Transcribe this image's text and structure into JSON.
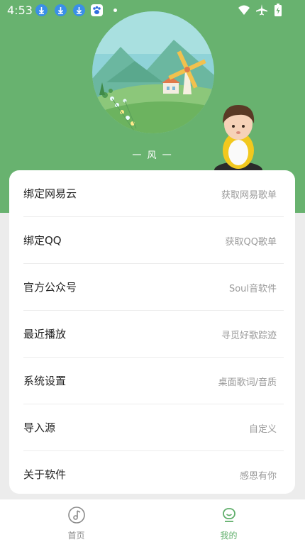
{
  "status_bar": {
    "time": "4:53",
    "notification_icons": [
      "download-icon",
      "download-icon",
      "download-icon",
      "baidu-paw-icon"
    ],
    "right_icons": [
      "wifi-icon",
      "airplane-icon",
      "battery-icon"
    ]
  },
  "player": {
    "song_label": "一 风 一"
  },
  "menu": {
    "items": [
      {
        "title": "绑定网易云",
        "subtitle": "获取网易歌单"
      },
      {
        "title": "绑定QQ",
        "subtitle": "获取QQ歌单"
      },
      {
        "title": "官方公众号",
        "subtitle": "Soul音软件"
      },
      {
        "title": "最近播放",
        "subtitle": "寻觅好歌踪迹"
      },
      {
        "title": "系统设置",
        "subtitle": "桌面歌词/音质"
      },
      {
        "title": "导入源",
        "subtitle": "自定义"
      },
      {
        "title": "关于软件",
        "subtitle": "感恩有你"
      }
    ]
  },
  "tabbar": {
    "tabs": [
      {
        "label": "首页",
        "icon": "music-disc-icon",
        "active": false
      },
      {
        "label": "我的",
        "icon": "profile-icon",
        "active": true
      }
    ]
  },
  "colors": {
    "header_green": "#68b26f",
    "active_tab": "#5fae6a",
    "inactive_tab": "#8a8a8a"
  }
}
